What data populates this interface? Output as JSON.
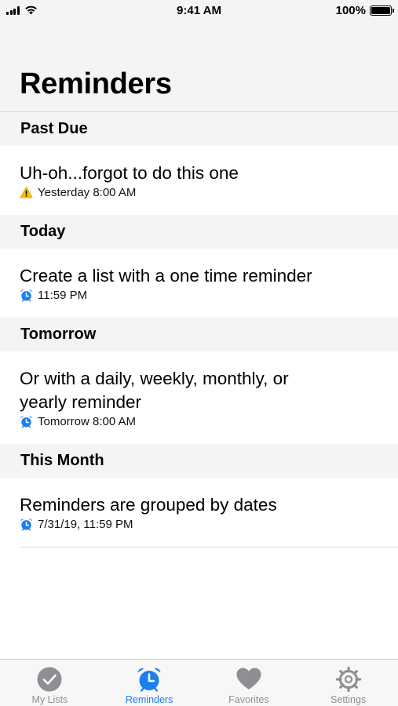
{
  "status_bar": {
    "time": "9:41 AM",
    "battery": "100%",
    "battery_level": 1.0
  },
  "header": {
    "title": "Reminders"
  },
  "sections": [
    {
      "title": "Past Due",
      "items": [
        {
          "title": "Uh-oh...forgot to do this one",
          "subtitle": "Yesterday 8:00 AM",
          "icon": "warning-icon"
        }
      ]
    },
    {
      "title": "Today",
      "items": [
        {
          "title": "Create a list with a one time reminder",
          "subtitle": "11:59 PM",
          "icon": "alarm-clock-icon"
        }
      ]
    },
    {
      "title": "Tomorrow",
      "items": [
        {
          "title": "Or with a daily, weekly, monthly, or yearly reminder",
          "subtitle": "Tomorrow 8:00 AM",
          "icon": "alarm-clock-icon"
        }
      ]
    },
    {
      "title": "This Month",
      "items": [
        {
          "title": "Reminders are grouped by dates",
          "subtitle": "7/31/19, 11:59 PM",
          "icon": "alarm-clock-icon"
        }
      ]
    }
  ],
  "tab_bar": {
    "tabs": [
      {
        "label": "My Lists",
        "icon": "checkmark-circle-icon",
        "active": false
      },
      {
        "label": "Reminders",
        "icon": "alarm-clock-icon",
        "active": true
      },
      {
        "label": "Favorites",
        "icon": "heart-icon",
        "active": false
      },
      {
        "label": "Settings",
        "icon": "gear-icon",
        "active": false
      }
    ]
  },
  "colors": {
    "accent": "#1a7ff0",
    "inactive": "#8e8e93",
    "warning": "#f5c300",
    "section_bg": "#f4f4f6"
  }
}
